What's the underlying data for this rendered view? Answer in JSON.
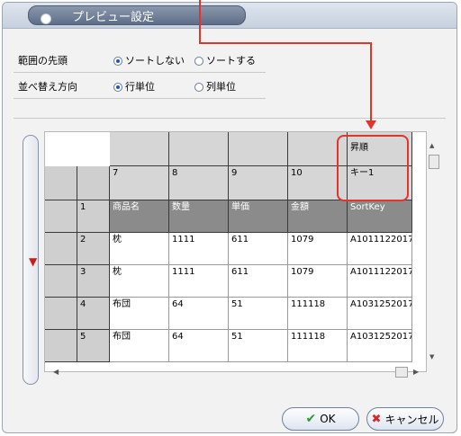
{
  "dialog": {
    "title": "プレビュー設定"
  },
  "options": {
    "range_label": "範囲の先頭",
    "range_options": [
      "ソートしない",
      "ソートする"
    ],
    "order_label": "並べ替え方向",
    "order_options": [
      "行単位",
      "列単位"
    ]
  },
  "grid": {
    "top_row": [
      "",
      "",
      "",
      "",
      "昇順"
    ],
    "number_row": [
      "7",
      "8",
      "9",
      "10",
      "キー1"
    ],
    "header_row": [
      "1",
      "商品名",
      "数量",
      "単価",
      "金額",
      "SortKey"
    ],
    "rows": [
      [
        "2",
        "枕",
        "1111",
        "611",
        "1079",
        "A1011122017"
      ],
      [
        "3",
        "枕",
        "1111",
        "611",
        "1079",
        "A1011122017"
      ],
      [
        "4",
        "布団",
        "64",
        "51",
        "111118",
        "A1031252017"
      ],
      [
        "5",
        "布団",
        "64",
        "51",
        "111118",
        "A1031252017"
      ]
    ]
  },
  "buttons": {
    "ok": "OK",
    "cancel": "キャンセル"
  },
  "colors": {
    "annotation": "#e0352b",
    "header": "#8b8b8b",
    "selected_radio": "#1a55c4"
  }
}
